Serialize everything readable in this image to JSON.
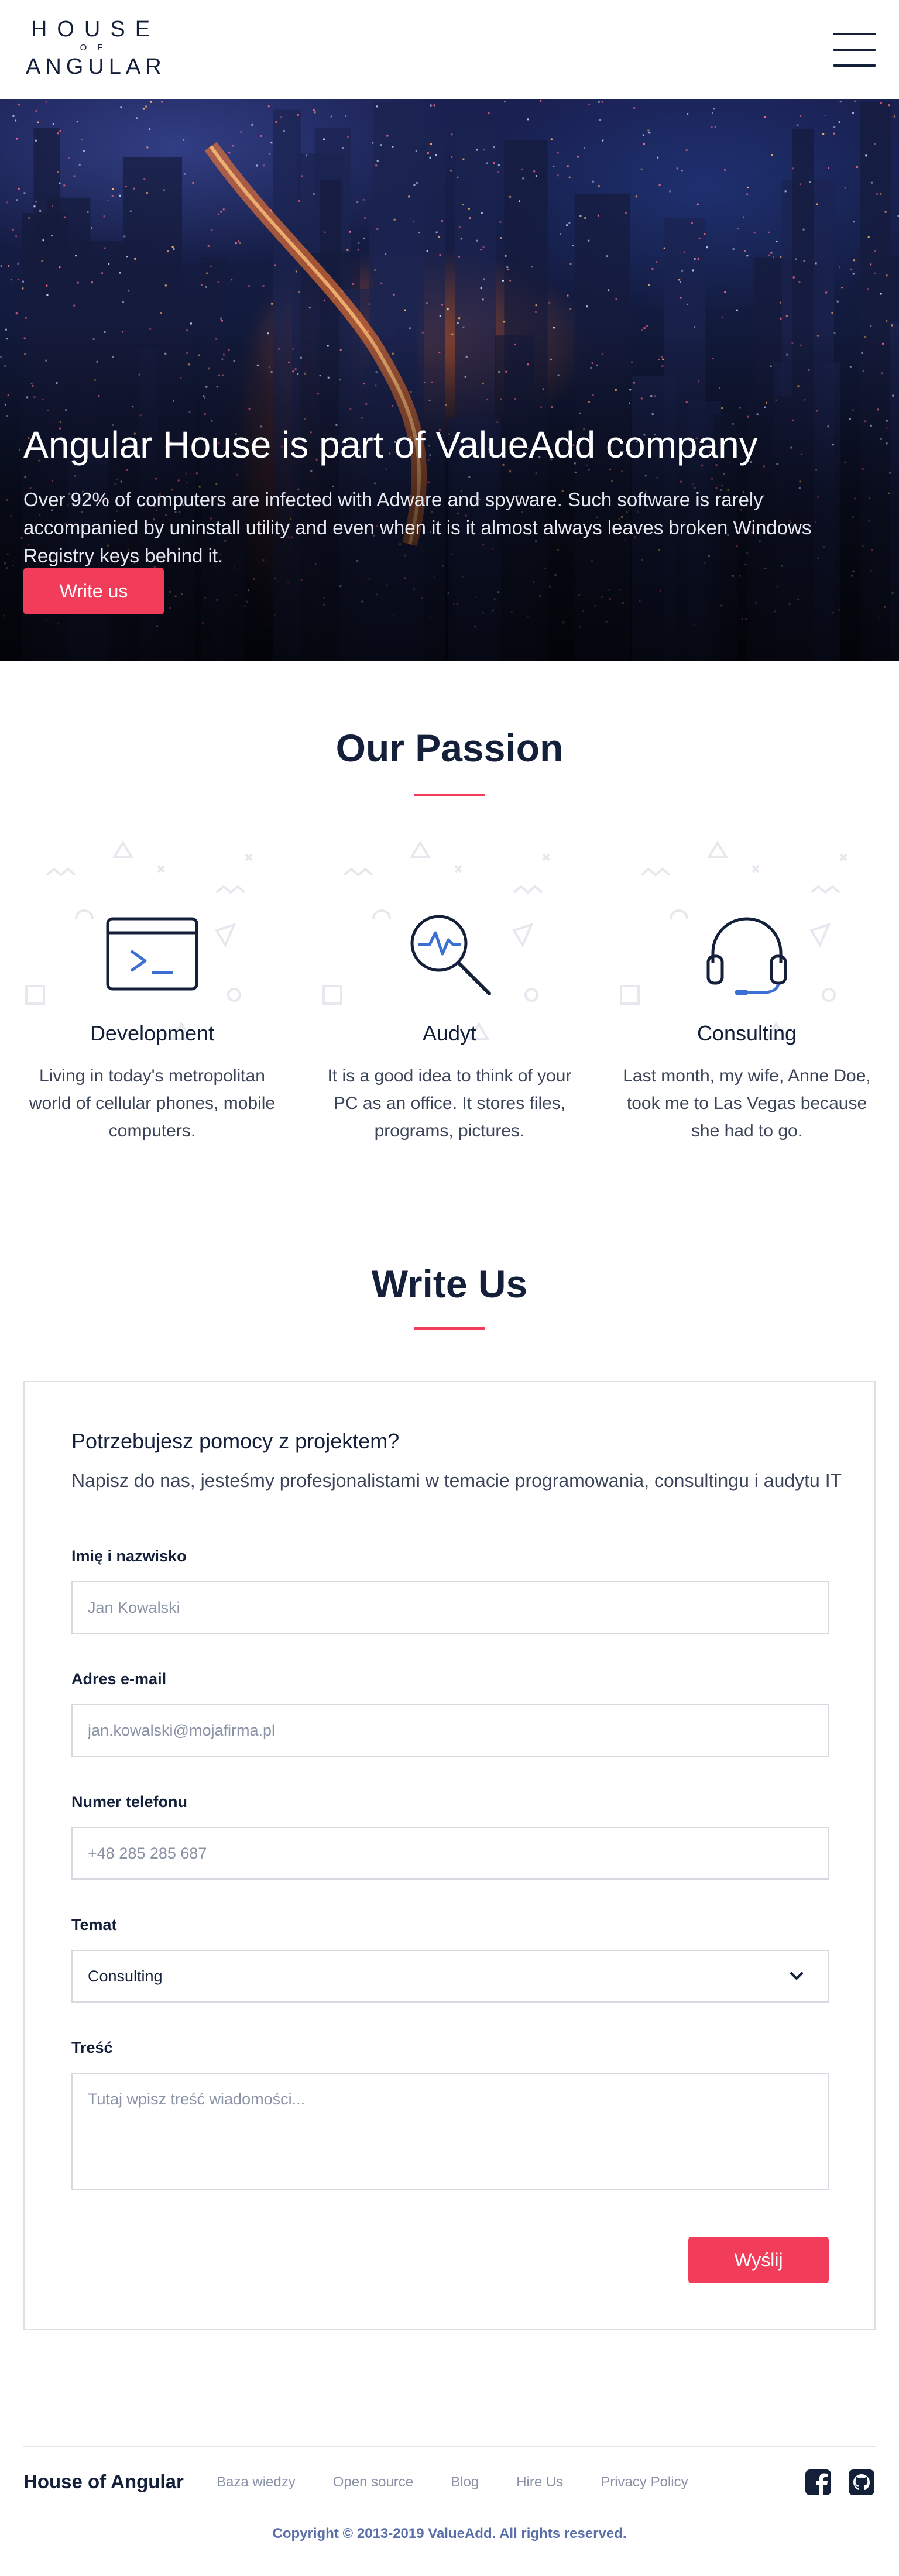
{
  "header": {
    "logo": {
      "line1": "HOUSE",
      "line2": "OF",
      "line3": "ANGULAR"
    },
    "menu_icon": "hamburger-menu-icon"
  },
  "hero": {
    "title": "Angular House is part of ValueAdd company",
    "text": "Over 92% of computers are infected with Adware and spyware. Such software is rarely accompanied by uninstall utility and even when it is it almost always leaves broken Windows Registry keys behind it.",
    "button": "Write us"
  },
  "passion": {
    "title": "Our Passion",
    "cards": [
      {
        "icon": "terminal-icon",
        "title": "Development",
        "text": "Living in today's metropolitan world of cellular phones, mobile computers."
      },
      {
        "icon": "magnifier-pulse-icon",
        "title": "Audyt",
        "text": "It is a good idea to think of your PC as an office. It stores files, programs, pictures."
      },
      {
        "icon": "headset-icon",
        "title": "Consulting",
        "text": "Last month, my wife, Anne Doe, took me to Las Vegas because she had to go."
      }
    ]
  },
  "contact": {
    "title": "Write Us",
    "heading": "Potrzebujesz pomocy z projektem?",
    "subheading": "Napisz do nas, jesteśmy profesjonalistami w temacie programowania, consultingu i audytu IT",
    "fields": {
      "name": {
        "label": "Imię i nazwisko",
        "placeholder": "Jan Kowalski"
      },
      "email": {
        "label": "Adres e-mail",
        "placeholder": "jan.kowalski@mojafirma.pl"
      },
      "phone": {
        "label": "Numer telefonu",
        "placeholder": "+48 285 285 687"
      },
      "topic": {
        "label": "Temat",
        "value": "Consulting"
      },
      "message": {
        "label": "Treść",
        "placeholder": "Tutaj wpisz treść wiadomości..."
      }
    },
    "submit": "Wyślij"
  },
  "footer": {
    "brand": "House of Angular",
    "links": [
      "Baza wiedzy",
      "Open source",
      "Blog",
      "Hire Us",
      "Privacy Policy"
    ],
    "social": [
      "facebook-icon",
      "github-icon"
    ],
    "copyright": "Copyright © 2013-2019 ValueAdd. All rights reserved."
  },
  "colors": {
    "accent": "#f23d5a",
    "navy": "#14203a",
    "link": "#8a92a6",
    "icon_blue": "#3b6fd4"
  }
}
